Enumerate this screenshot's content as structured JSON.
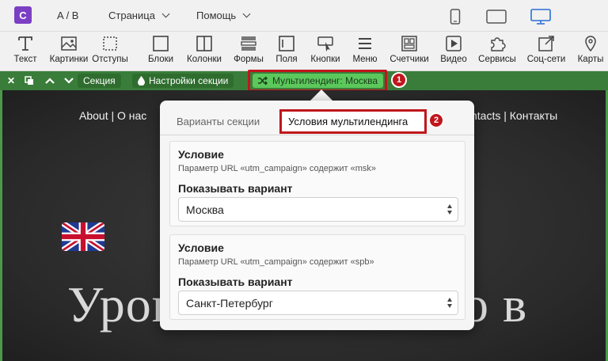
{
  "topbar": {
    "logo": "C",
    "ab": "A / B",
    "page_menu": "Страница",
    "help_menu": "Помощь"
  },
  "toolbar": {
    "items": [
      "Текст",
      "Картинки",
      "Отступы",
      "Блоки",
      "Колонки",
      "Формы",
      "Поля",
      "Кнопки",
      "Меню",
      "Счетчики",
      "Видео",
      "Сервисы",
      "Соц-сети",
      "Карты"
    ]
  },
  "section_bar": {
    "section_label": "Секция",
    "settings_label": "Настройки секции",
    "multilanding_label": "Мультилендинг: Москва",
    "badge1": "1"
  },
  "page": {
    "nav_left": "About | О нас",
    "nav_right": "ntacts | Контакты",
    "title": "Уроки английского в"
  },
  "popup": {
    "tab_variants": "Варианты секции",
    "tab_conditions": "Условия мультилендинга",
    "badge2": "2",
    "cards": [
      {
        "heading": "Условие",
        "description": "Параметр URL «utm_campaign» содержит «msk»",
        "show_label": "Показывать вариант",
        "selected": "Москва"
      },
      {
        "heading": "Условие",
        "description": "Параметр URL «utm_campaign» содержит «spb»",
        "show_label": "Показывать вариант",
        "selected": "Санкт-Петербург"
      }
    ]
  },
  "colors": {
    "accent_green": "#5cc85c",
    "highlight_red": "#c0161c",
    "logo_purple": "#7b3fc4"
  }
}
